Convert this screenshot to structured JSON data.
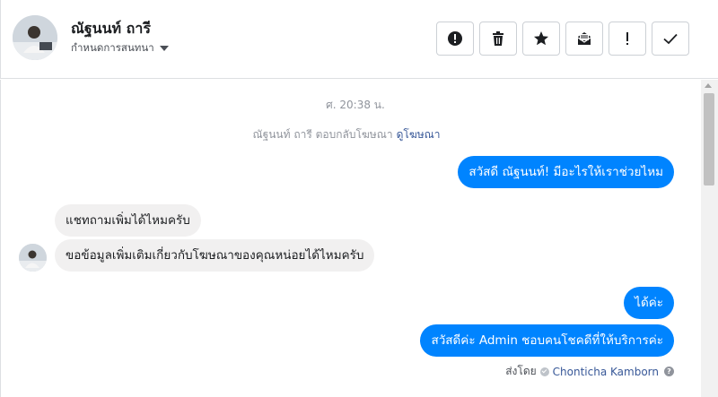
{
  "header": {
    "contact_name": "ณัฐนนท์ ถารี",
    "assign_label": "กำหนดการสนทนา",
    "buttons": [
      {
        "name": "spam-button",
        "icon": "alert-circle-icon"
      },
      {
        "name": "delete-button",
        "icon": "trash-icon"
      },
      {
        "name": "star-button",
        "icon": "star-icon"
      },
      {
        "name": "mark-unread-button",
        "icon": "envelope-icon"
      },
      {
        "name": "follow-up-button",
        "icon": "exclamation-icon"
      },
      {
        "name": "mark-done-button",
        "icon": "check-icon"
      }
    ]
  },
  "conversation": {
    "timestamp": "ศ. 20:38 น.",
    "notice_text": "ณัฐนนท์ ถารี ตอบกลับโฆษณา",
    "notice_link": "ดูโฆษณา",
    "messages": [
      {
        "direction": "out",
        "text": "สวัสดี ณัฐนนท์! มีอะไรให้เราช่วยไหม"
      },
      {
        "direction": "in",
        "text": "แชทถามเพิ่มได้ไหมครับ"
      },
      {
        "direction": "in",
        "text": "ขอข้อมูลเพิ่มเติมเกี่ยวกับโฆษณาของคุณหน่อยได้ไหมครับ"
      },
      {
        "direction": "out",
        "text": "ได้ค่ะ"
      },
      {
        "direction": "out",
        "text": "สวัสดีค่ะ Admin ชอบคนโชคดีที่ให้บริการค่ะ"
      }
    ],
    "sent_by_label": "ส่งโดย",
    "sent_by_name": "Chonticha Kamborn"
  },
  "colors": {
    "outgoing_bubble": "#0084ff",
    "incoming_bubble": "#f1f0f0",
    "link": "#385898"
  }
}
